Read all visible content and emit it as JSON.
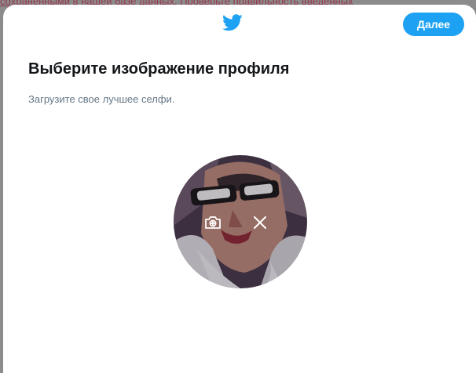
{
  "background": {
    "partial_text": "сохраненными в нашей базе данных. Проверьте правильность введенных"
  },
  "header": {
    "logo_icon": "twitter-bird-icon",
    "next_button_label": "Далее"
  },
  "main": {
    "title": "Выберите изображение профиля",
    "subtitle": "Загрузите свое лучшее селфи."
  },
  "avatar": {
    "upload_icon": "camera-plus-icon",
    "remove_icon": "close-icon"
  },
  "colors": {
    "accent": "#1da1f2",
    "title": "#14171a",
    "subtitle": "#657786",
    "backdrop": "#8c8c8c"
  }
}
